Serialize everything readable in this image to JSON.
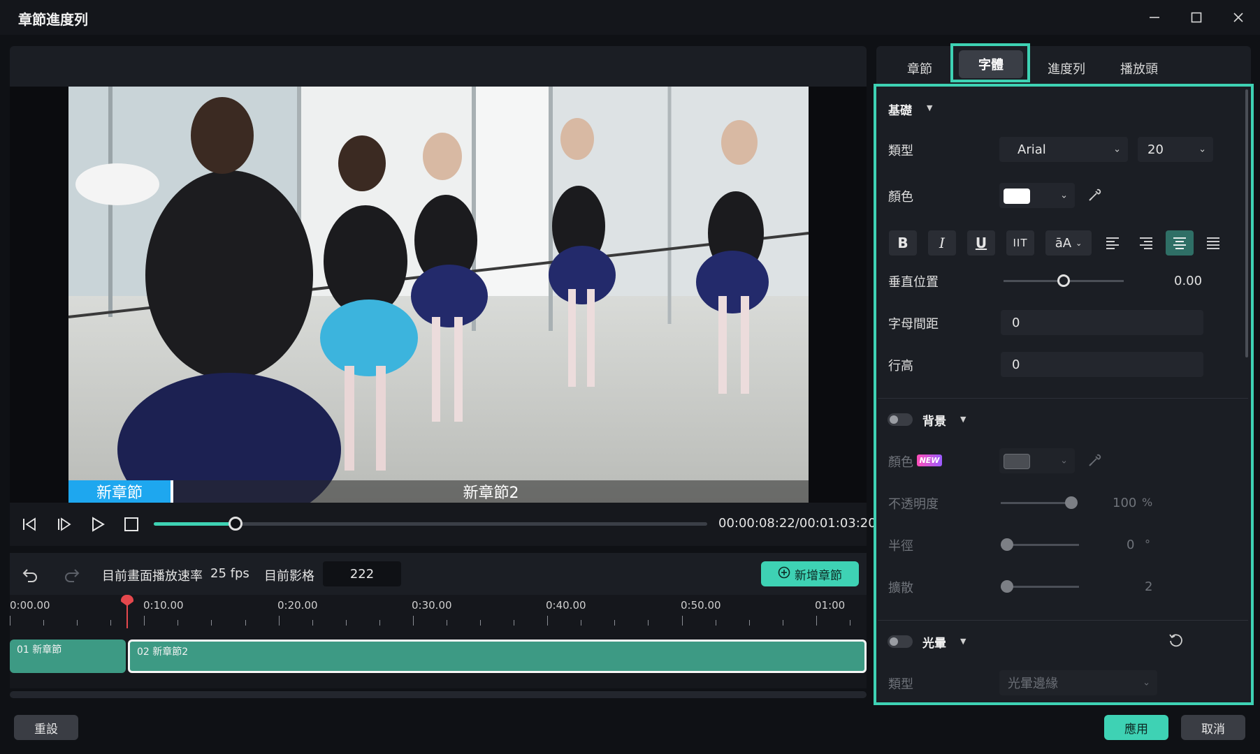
{
  "window": {
    "title": "章節進度列",
    "minimize_icon": "minimize-icon",
    "maximize_icon": "maximize-icon",
    "close_icon": "close-icon"
  },
  "preview": {
    "chapter_labels": [
      "新章節",
      "新章節2"
    ],
    "timecode": "00:00:08:22/00:01:03:20",
    "progress_fraction": 0.148
  },
  "playback_controls": [
    "prev-frame-icon",
    "next-frame-icon",
    "play-icon",
    "stop-icon"
  ],
  "timeline_toolbar": {
    "playback_rate_label": "目前畫面播放速率",
    "playback_rate_value": "25 fps",
    "current_frame_label": "目前影格",
    "current_frame_value": "222",
    "add_chapter_label": "新增章節"
  },
  "ruler": {
    "labels": [
      "0:00.00",
      "0:10.00",
      "0:20.00",
      "0:30.00",
      "0:40.00",
      "0:50.00",
      "01:00"
    ]
  },
  "track": {
    "clips": [
      {
        "label": "01 新章節"
      },
      {
        "label": "02 新章節2"
      }
    ]
  },
  "tabs": [
    "章節",
    "字體",
    "進度列",
    "播放頭"
  ],
  "active_tab": "字體",
  "font_panel": {
    "basic": {
      "title": "基礎",
      "type_label": "類型",
      "font_family_value": "Arial",
      "font_size_value": "20",
      "color_label": "顏色",
      "color_value": "#ffffff",
      "format_buttons": [
        "B",
        "I",
        "U",
        "IIT",
        "āA"
      ],
      "align_buttons": [
        "align-left-icon",
        "align-right-icon",
        "align-center-icon",
        "align-justify-icon"
      ],
      "vertical_pos_label": "垂直位置",
      "vertical_pos_value": "0.00",
      "letter_spacing_label": "字母間距",
      "letter_spacing_value": "0",
      "line_height_label": "行高",
      "line_height_value": "0"
    },
    "background": {
      "title": "背景",
      "color_label": "顏色",
      "new_badge": "NEW",
      "color_value": "#4a4d53",
      "opacity_label": "不透明度",
      "opacity_value": "100",
      "opacity_unit": "%",
      "radius_label": "半徑",
      "radius_value": "0",
      "radius_unit": "°",
      "spread_label": "擴散",
      "spread_value": "2"
    },
    "glow": {
      "title": "光暈",
      "type_label": "類型",
      "type_value": "光暈邊緣"
    }
  },
  "footer": {
    "reset_label": "重設",
    "apply_label": "應用",
    "cancel_label": "取消"
  },
  "colors": {
    "accent": "#3ed2b4",
    "chapter_bar": "#1ea7ef",
    "playhead": "#e5484d",
    "clip": "#3d9a84"
  }
}
